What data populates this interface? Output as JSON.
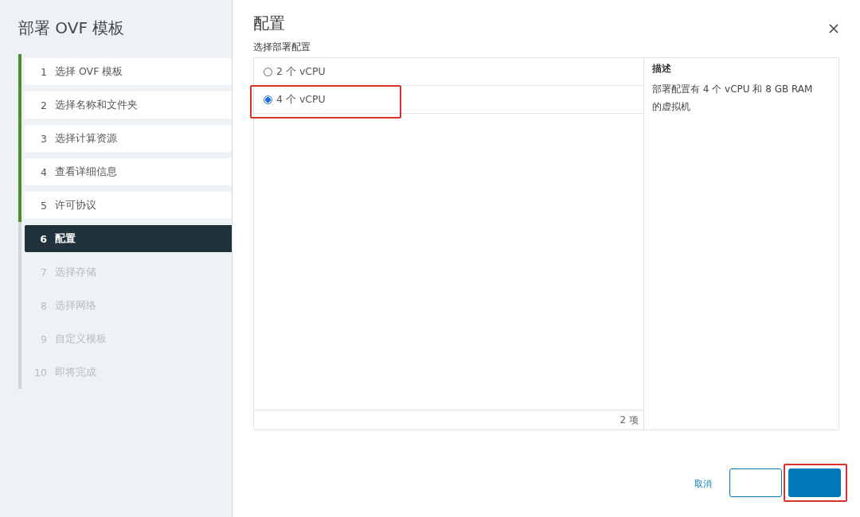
{
  "wizard": {
    "title": "部署 OVF 模板"
  },
  "steps": [
    {
      "number": "1",
      "label": "选择 OVF 模板",
      "completed": true,
      "selected": false
    },
    {
      "number": "2",
      "label": "选择名称和文件夹",
      "completed": true,
      "selected": false
    },
    {
      "number": "3",
      "label": "选择计算资源",
      "completed": true,
      "selected": false
    },
    {
      "number": "4",
      "label": "查看详细信息",
      "completed": true,
      "selected": false
    },
    {
      "number": "5",
      "label": "许可协议",
      "completed": true,
      "selected": false
    },
    {
      "number": "6",
      "label": "配置",
      "completed": false,
      "selected": true
    },
    {
      "number": "7",
      "label": "选择存储",
      "completed": false,
      "selected": false
    },
    {
      "number": "8",
      "label": "选择网络",
      "completed": false,
      "selected": false
    },
    {
      "number": "9",
      "label": "自定义模板",
      "completed": false,
      "selected": false
    },
    {
      "number": "10",
      "label": "即将完成",
      "completed": false,
      "selected": false
    }
  ],
  "page": {
    "title": "配置",
    "section_label": "选择部署配置"
  },
  "options": [
    {
      "label": "2 个 vCPU",
      "selected": false
    },
    {
      "label": "4 个 vCPU",
      "selected": true,
      "highlighted": true
    }
  ],
  "list_footer": "2 项",
  "description": {
    "heading": "描述",
    "text": "部署配置有 4 个 vCPU 和 8 GB RAM 的虚拟机"
  },
  "buttons": [
    {
      "kind": "link",
      "label": "取消"
    },
    {
      "kind": "outline"
    },
    {
      "kind": "primary",
      "highlighted": true
    }
  ]
}
